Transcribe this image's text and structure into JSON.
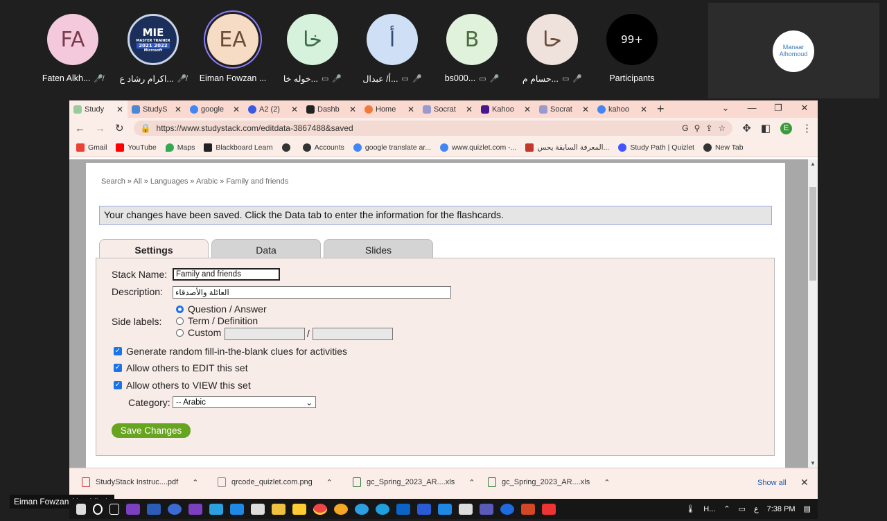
{
  "participants": [
    {
      "initials": "FA",
      "name": "Faten Alkh...",
      "color": "#f4c9dc"
    },
    {
      "initials": "MIE",
      "name": "اكرام رشاد ع...",
      "color": "#1b2f5a"
    },
    {
      "initials": "EA",
      "name": "Eiman Fowzan ...",
      "color": "#f6dcc4"
    },
    {
      "initials": "خا",
      "name": "خوله خا...",
      "color": "#d7f2dc"
    },
    {
      "initials": "أ",
      "name": "أ/ عبدال...",
      "color": "#cfe0f6"
    },
    {
      "initials": "B",
      "name": "bs000...",
      "color": "#e1f2dc"
    },
    {
      "initials": "حا",
      "name": "حسام م...",
      "color": "#efe2dc"
    },
    {
      "initials": "99+",
      "name": "Participants",
      "color": "#000000"
    }
  ],
  "mie_badge": {
    "title": "MIE",
    "line2": "MASTER TRAINER",
    "years": "2021 2022",
    "brand": "Microsoft"
  },
  "logo_text": "Manaar Alhomoud",
  "tabs": [
    {
      "label": "Study",
      "color": "#9c9"
    },
    {
      "label": "StudyS",
      "color": "#4a8ad4"
    },
    {
      "label": "google",
      "color": "#4285f4"
    },
    {
      "label": "A2 (2)",
      "color": "#3a5ae0"
    },
    {
      "label": "Dashb",
      "color": "#222"
    },
    {
      "label": "Home",
      "color": "#f07a3a"
    },
    {
      "label": "Socrat",
      "color": "#9a9acd"
    },
    {
      "label": "Kahoo",
      "color": "#46178f"
    },
    {
      "label": "Socrat",
      "color": "#9a9acd"
    },
    {
      "label": "kahoo",
      "color": "#4285f4"
    }
  ],
  "url": "https://www.studystack.com/editdata-3867488&saved",
  "profile_initial": "E",
  "bookmarks": [
    {
      "label": "Gmail",
      "color": "#ea4335"
    },
    {
      "label": "YouTube",
      "color": "#ff0000"
    },
    {
      "label": "Maps",
      "color": "#34a853"
    },
    {
      "label": "Blackboard Learn",
      "color": "#222"
    },
    {
      "label": "",
      "color": "#333"
    },
    {
      "label": "Accounts",
      "color": "#333"
    },
    {
      "label": "google translate ar...",
      "color": "#4285f4"
    },
    {
      "label": "www.quizlet.com -...",
      "color": "#4285f4"
    },
    {
      "label": "المعرفة السابقة يحس...",
      "color": "#c0392b"
    },
    {
      "label": "Study Path | Quizlet",
      "color": "#4255ff"
    },
    {
      "label": "New Tab",
      "color": "#333"
    }
  ],
  "breadcrumb": "Search » All » Languages » Arabic » Family and friends",
  "notice": "Your changes have been saved. Click the Data tab to enter the information for the flashcards.",
  "form_tabs": [
    "Settings",
    "Data",
    "Slides"
  ],
  "form": {
    "stack_name_label": "Stack Name:",
    "stack_name": "Family and friends",
    "description_label": "Description:",
    "description": "العائلة والأصدقاء",
    "side_labels_label": "Side labels:",
    "radio_options": [
      "Question / Answer",
      "Term / Definition",
      "Custom"
    ],
    "custom_sep": "/",
    "checkboxes": [
      "Generate random fill-in-the-blank clues for activities",
      "Allow others to EDIT this set",
      "Allow others to VIEW this set"
    ],
    "category_label": "Category:",
    "category": "-- Arabic",
    "save": "Save Changes"
  },
  "downloads": [
    "StudyStack Instruc....pdf",
    "qrcode_quizlet.com.png",
    "gc_Spring_2023_AR....xls",
    "gc_Spring_2023_AR....xls"
  ],
  "show_all": "Show all",
  "self_name": "Eiman Fowzan Abushihab",
  "tray": {
    "label": "H...",
    "lang": "ع",
    "time": "7:38 PM"
  }
}
